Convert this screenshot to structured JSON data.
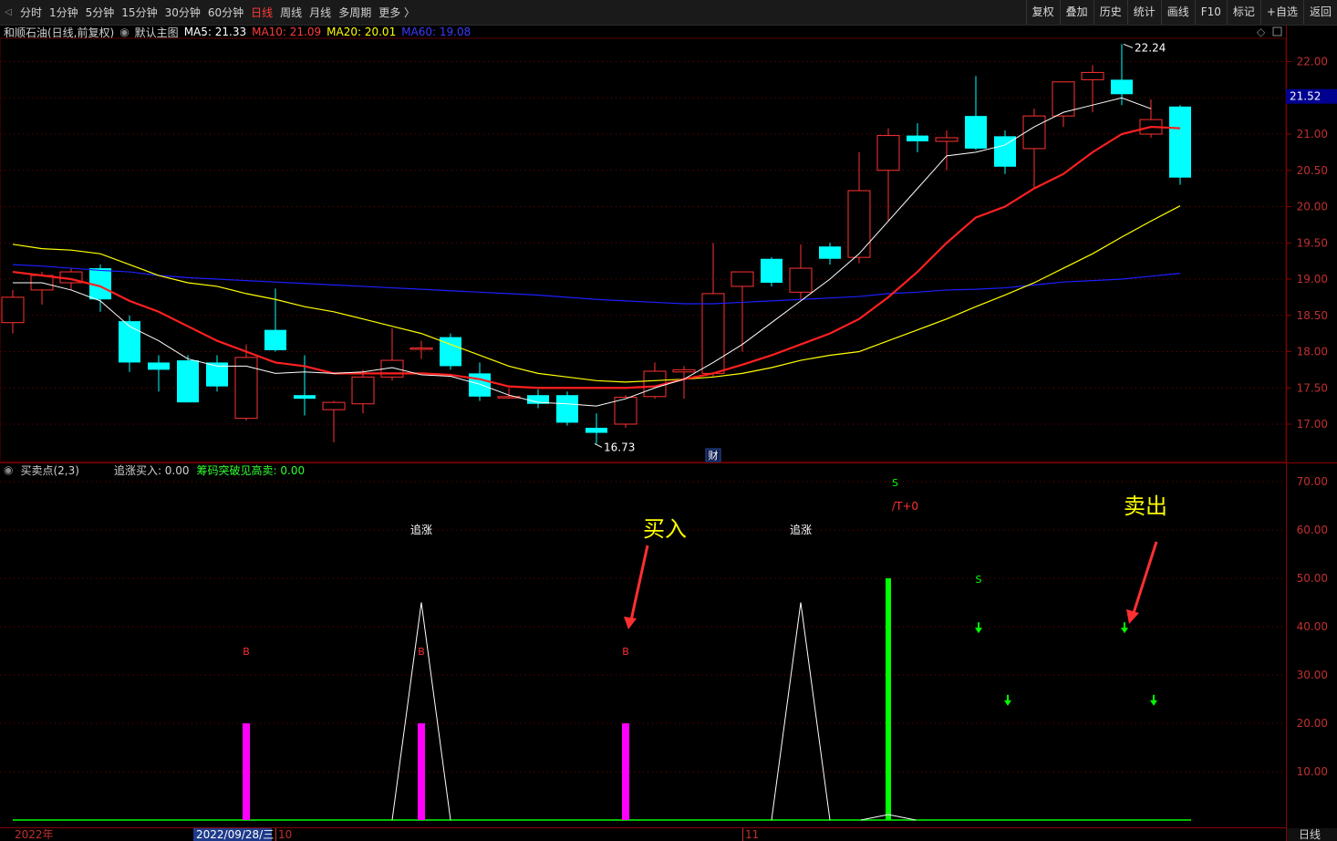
{
  "toolbar": {
    "periods": [
      "分时",
      "1分钟",
      "5分钟",
      "15分钟",
      "30分钟",
      "60分钟",
      "日线",
      "周线",
      "月线",
      "多周期",
      "更多 〉"
    ],
    "active_period": "日线",
    "right_buttons": [
      "复权",
      "叠加",
      "历史",
      "统计",
      "画线",
      "F10",
      "标记",
      "+自选",
      "返回"
    ]
  },
  "main": {
    "stock_title": "和顺石油(日线,前复权)",
    "template": "默认主图",
    "ma5": "MA5: 21.33",
    "ma10": "MA10: 21.09",
    "ma20": "MA20: 20.01",
    "ma60": "MA60: 19.08",
    "current_price": "21.52",
    "high_label": "22.24",
    "low_label": "16.73",
    "event_tag": "财",
    "y_ticks": [
      17.0,
      17.5,
      18.0,
      18.5,
      19.0,
      19.5,
      20.0,
      20.5,
      21.0,
      21.5,
      22.0
    ],
    "y_tick_labels": [
      "17.00",
      "17.50",
      "18.00",
      "18.50",
      "19.00",
      "19.50",
      "20.00",
      "20.50",
      "21.00",
      "21.50",
      "22.00"
    ]
  },
  "indicator": {
    "name": "买卖点(2,3)",
    "value1": "追涨买入: 0.00",
    "value2": "筹码突破见高卖: 0.00",
    "y_ticks": [
      10,
      20,
      30,
      40,
      50,
      60,
      70
    ],
    "y_tick_labels": [
      "10.00",
      "20.00",
      "30.00",
      "40.00",
      "50.00",
      "60.00",
      "70.00"
    ],
    "buy_annotation": "买入",
    "sell_annotation": "卖出",
    "chase_label": "追涨",
    "b_label": "B",
    "s_label": "S",
    "t0_label": "/T+0",
    "bars": [
      {
        "candle": 8,
        "value": 20
      },
      {
        "candle": 14,
        "value": 20
      },
      {
        "candle": 21,
        "value": 20
      }
    ],
    "triangles": [
      {
        "candle": 14,
        "value": 45
      },
      {
        "candle": 27,
        "value": 45
      }
    ],
    "green_bar": {
      "candle": 30,
      "value": 50
    },
    "arrows": [
      {
        "candle": 33,
        "value": 39
      },
      {
        "candle": 34,
        "value": 24
      },
      {
        "candle": 38,
        "value": 39
      },
      {
        "candle": 39,
        "value": 24
      }
    ]
  },
  "footer": {
    "year": "2022年",
    "date": "2022/09/28/三",
    "month10": "10",
    "month11": "11",
    "period": "日线"
  },
  "colors": {
    "up": "#ff3232",
    "down": "#00ffff",
    "ma5": "#ffffff",
    "ma10": "#ff2020",
    "ma20": "#ffff00",
    "ma60": "#1e1eff",
    "grid": "#7a0000",
    "axis_text": "#c03030",
    "magenta": "#ff00ff",
    "green": "#00ff00"
  },
  "chart_data": {
    "type": "candlestick",
    "title": "和顺石油(日线,前复权)",
    "ylim": [
      16.6,
      22.4
    ],
    "candles": [
      {
        "o": 18.4,
        "h": 18.85,
        "l": 18.25,
        "c": 18.75
      },
      {
        "o": 18.85,
        "h": 19.1,
        "l": 18.65,
        "c": 19.05
      },
      {
        "o": 18.95,
        "h": 19.15,
        "l": 18.85,
        "c": 19.1
      },
      {
        "o": 19.15,
        "h": 19.2,
        "l": 18.55,
        "c": 18.72
      },
      {
        "o": 18.42,
        "h": 18.5,
        "l": 17.72,
        "c": 17.85
      },
      {
        "o": 17.85,
        "h": 17.95,
        "l": 17.45,
        "c": 17.75
      },
      {
        "o": 17.88,
        "h": 17.95,
        "l": 17.3,
        "c": 17.3
      },
      {
        "o": 17.85,
        "h": 17.95,
        "l": 17.45,
        "c": 17.52
      },
      {
        "o": 17.08,
        "h": 18.1,
        "l": 17.05,
        "c": 17.92
      },
      {
        "o": 18.3,
        "h": 18.87,
        "l": 18.0,
        "c": 18.02
      },
      {
        "o": 17.4,
        "h": 17.95,
        "l": 17.12,
        "c": 17.35
      },
      {
        "o": 17.2,
        "h": 17.32,
        "l": 16.75,
        "c": 17.3
      },
      {
        "o": 17.28,
        "h": 17.75,
        "l": 17.15,
        "c": 17.65
      },
      {
        "o": 17.65,
        "h": 18.32,
        "l": 17.6,
        "c": 17.88
      },
      {
        "o": 18.05,
        "h": 18.15,
        "l": 17.9,
        "c": 18.05
      },
      {
        "o": 18.2,
        "h": 18.25,
        "l": 17.75,
        "c": 17.8
      },
      {
        "o": 17.7,
        "h": 17.85,
        "l": 17.32,
        "c": 17.38
      },
      {
        "o": 17.38,
        "h": 17.5,
        "l": 17.35,
        "c": 17.38
      },
      {
        "o": 17.4,
        "h": 17.48,
        "l": 17.22,
        "c": 17.28
      },
      {
        "o": 17.4,
        "h": 17.45,
        "l": 16.98,
        "c": 17.02
      },
      {
        "o": 16.95,
        "h": 17.15,
        "l": 16.73,
        "c": 16.88
      },
      {
        "o": 17.0,
        "h": 17.4,
        "l": 16.95,
        "c": 17.37
      },
      {
        "o": 17.38,
        "h": 17.85,
        "l": 17.35,
        "c": 17.73
      },
      {
        "o": 17.72,
        "h": 17.8,
        "l": 17.35,
        "c": 17.75
      },
      {
        "o": 17.7,
        "h": 19.5,
        "l": 17.65,
        "c": 18.8
      },
      {
        "o": 18.9,
        "h": 19.05,
        "l": 18.0,
        "c": 19.1
      },
      {
        "o": 19.28,
        "h": 19.3,
        "l": 18.9,
        "c": 18.95
      },
      {
        "o": 18.82,
        "h": 19.48,
        "l": 18.72,
        "c": 19.15
      },
      {
        "o": 19.45,
        "h": 19.5,
        "l": 19.2,
        "c": 19.28
      },
      {
        "o": 19.3,
        "h": 20.75,
        "l": 19.22,
        "c": 20.22
      },
      {
        "o": 20.5,
        "h": 21.08,
        "l": 19.8,
        "c": 20.98
      },
      {
        "o": 20.98,
        "h": 21.15,
        "l": 20.75,
        "c": 20.9
      },
      {
        "o": 20.9,
        "h": 21.05,
        "l": 20.5,
        "c": 20.95
      },
      {
        "o": 21.25,
        "h": 21.8,
        "l": 20.78,
        "c": 20.8
      },
      {
        "o": 20.97,
        "h": 21.05,
        "l": 20.45,
        "c": 20.55
      },
      {
        "o": 20.8,
        "h": 21.35,
        "l": 20.25,
        "c": 21.25
      },
      {
        "o": 21.25,
        "h": 21.72,
        "l": 21.1,
        "c": 21.72
      },
      {
        "o": 21.75,
        "h": 21.95,
        "l": 21.3,
        "c": 21.85
      },
      {
        "o": 21.75,
        "h": 22.24,
        "l": 21.4,
        "c": 21.55
      },
      {
        "o": 21.0,
        "h": 21.48,
        "l": 20.95,
        "c": 21.2
      },
      {
        "o": 21.38,
        "h": 21.4,
        "l": 20.3,
        "c": 20.4
      }
    ],
    "ma5": [
      18.95,
      18.95,
      18.85,
      18.7,
      18.35,
      18.15,
      17.9,
      17.8,
      17.8,
      17.7,
      17.72,
      17.7,
      17.72,
      17.78,
      17.68,
      17.66,
      17.55,
      17.4,
      17.3,
      17.28,
      17.25,
      17.35,
      17.5,
      17.62,
      17.85,
      18.1,
      18.4,
      18.7,
      19.0,
      19.35,
      19.8,
      20.25,
      20.7,
      20.75,
      20.85,
      21.1,
      21.3,
      21.4,
      21.5,
      21.35
    ],
    "ma10": [
      19.1,
      19.05,
      19.0,
      18.9,
      18.7,
      18.55,
      18.35,
      18.15,
      18.0,
      17.85,
      17.8,
      17.7,
      17.7,
      17.7,
      17.7,
      17.68,
      17.62,
      17.52,
      17.5,
      17.5,
      17.5,
      17.5,
      17.52,
      17.62,
      17.7,
      17.82,
      17.95,
      18.1,
      18.25,
      18.45,
      18.75,
      19.1,
      19.5,
      19.85,
      20.0,
      20.25,
      20.45,
      20.75,
      21.0,
      21.1,
      21.08
    ],
    "ma20": [
      19.48,
      19.42,
      19.4,
      19.35,
      19.2,
      19.05,
      18.95,
      18.9,
      18.8,
      18.72,
      18.62,
      18.55,
      18.45,
      18.35,
      18.25,
      18.1,
      17.95,
      17.8,
      17.7,
      17.65,
      17.6,
      17.58,
      17.6,
      17.62,
      17.65,
      17.7,
      17.78,
      17.88,
      17.95,
      18.0,
      18.15,
      18.3,
      18.45,
      18.62,
      18.78,
      18.95,
      19.15,
      19.35,
      19.58,
      19.8,
      20.01
    ],
    "ma60": [
      19.2,
      19.18,
      19.15,
      19.12,
      19.1,
      19.05,
      19.02,
      19.0,
      18.98,
      18.96,
      18.94,
      18.92,
      18.9,
      18.88,
      18.86,
      18.84,
      18.82,
      18.8,
      18.78,
      18.75,
      18.72,
      18.7,
      18.68,
      18.66,
      18.66,
      18.68,
      18.7,
      18.72,
      18.74,
      18.76,
      18.8,
      18.82,
      18.85,
      18.86,
      18.88,
      18.92,
      18.96,
      18.98,
      19.0,
      19.04,
      19.08
    ]
  }
}
